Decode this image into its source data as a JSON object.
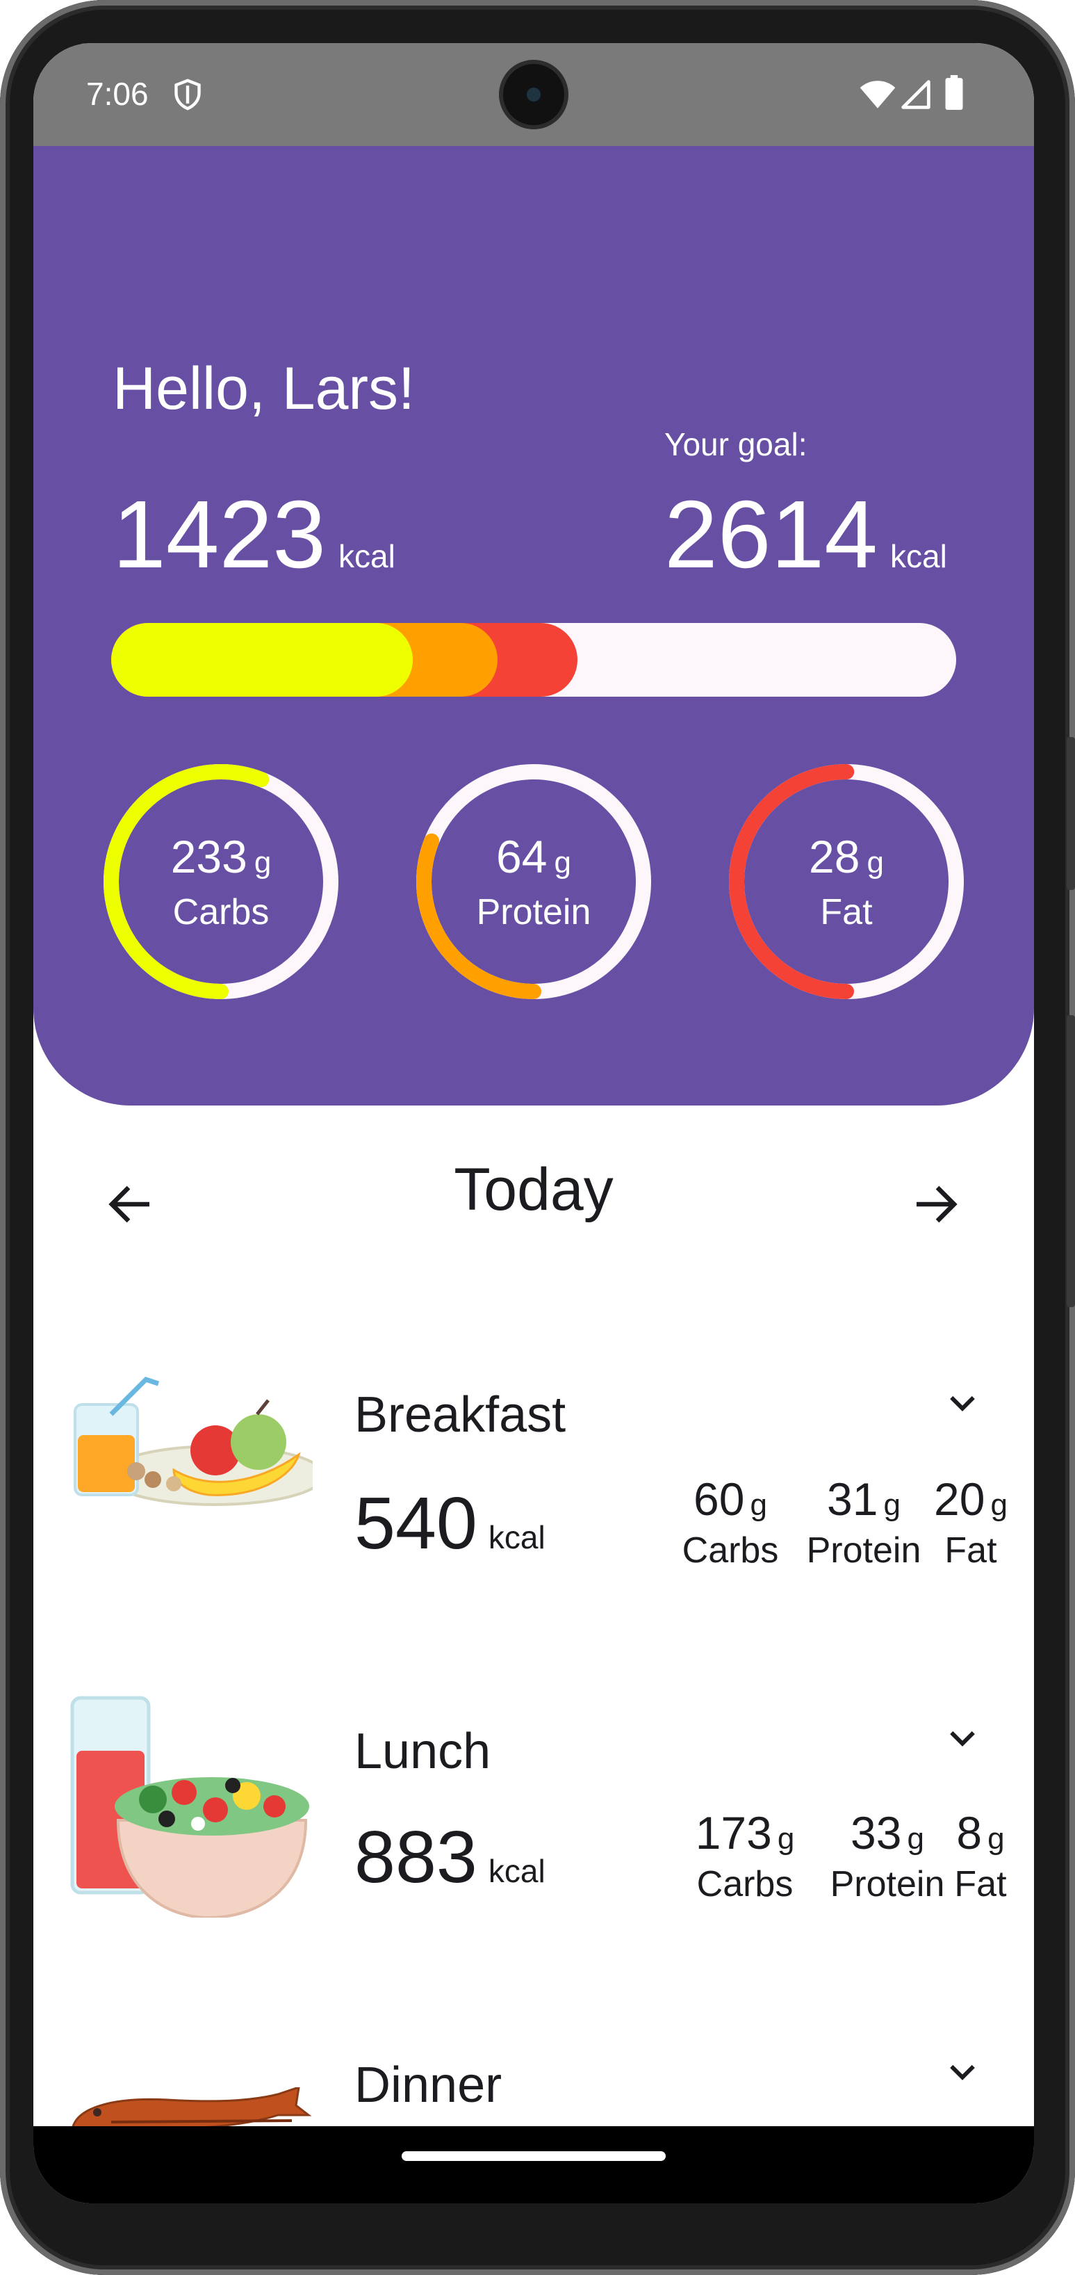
{
  "status_bar": {
    "time": "7:06",
    "icons": [
      "shield-icon",
      "wifi-icon",
      "signal-icon",
      "battery-icon"
    ]
  },
  "header": {
    "greeting": "Hello, Lars!",
    "goal_label": "Your goal:",
    "eaten_kcal": "1423",
    "goal_kcal": "2614",
    "unit": "kcal",
    "colors": {
      "background": "#6750a4",
      "carbs": "#eeff00",
      "protein": "#ffa000",
      "fat": "#f44336",
      "track": "#fdf6fb"
    },
    "progress_fraction": {
      "carbs": 0.357,
      "protein": 0.1,
      "fat": 0.095
    },
    "macros": [
      {
        "value": "233",
        "unit": "g",
        "name": "Carbs",
        "progress": 0.56,
        "color": "#eeff00"
      },
      {
        "value": "64",
        "unit": "g",
        "name": "Protein",
        "progress": 0.31,
        "color": "#ffa000"
      },
      {
        "value": "28",
        "unit": "g",
        "name": "Fat",
        "progress": 0.5,
        "color": "#f44336"
      }
    ]
  },
  "date_nav": {
    "title": "Today",
    "prev_icon": "arrow-left-icon",
    "next_icon": "arrow-right-icon"
  },
  "meals": [
    {
      "name": "Breakfast",
      "kcal": "540",
      "unit": "kcal",
      "image": "breakfast-image",
      "macros": [
        {
          "value": "60",
          "unit": "g",
          "name": "Carbs"
        },
        {
          "value": "31",
          "unit": "g",
          "name": "Protein"
        },
        {
          "value": "20",
          "unit": "g",
          "name": "Fat"
        }
      ]
    },
    {
      "name": "Lunch",
      "kcal": "883",
      "unit": "kcal",
      "image": "lunch-image",
      "macros": [
        {
          "value": "173",
          "unit": "g",
          "name": "Carbs"
        },
        {
          "value": "33",
          "unit": "g",
          "name": "Protein"
        },
        {
          "value": "8",
          "unit": "g",
          "name": "Fat"
        }
      ]
    },
    {
      "name": "Dinner",
      "image": "dinner-image"
    }
  ]
}
